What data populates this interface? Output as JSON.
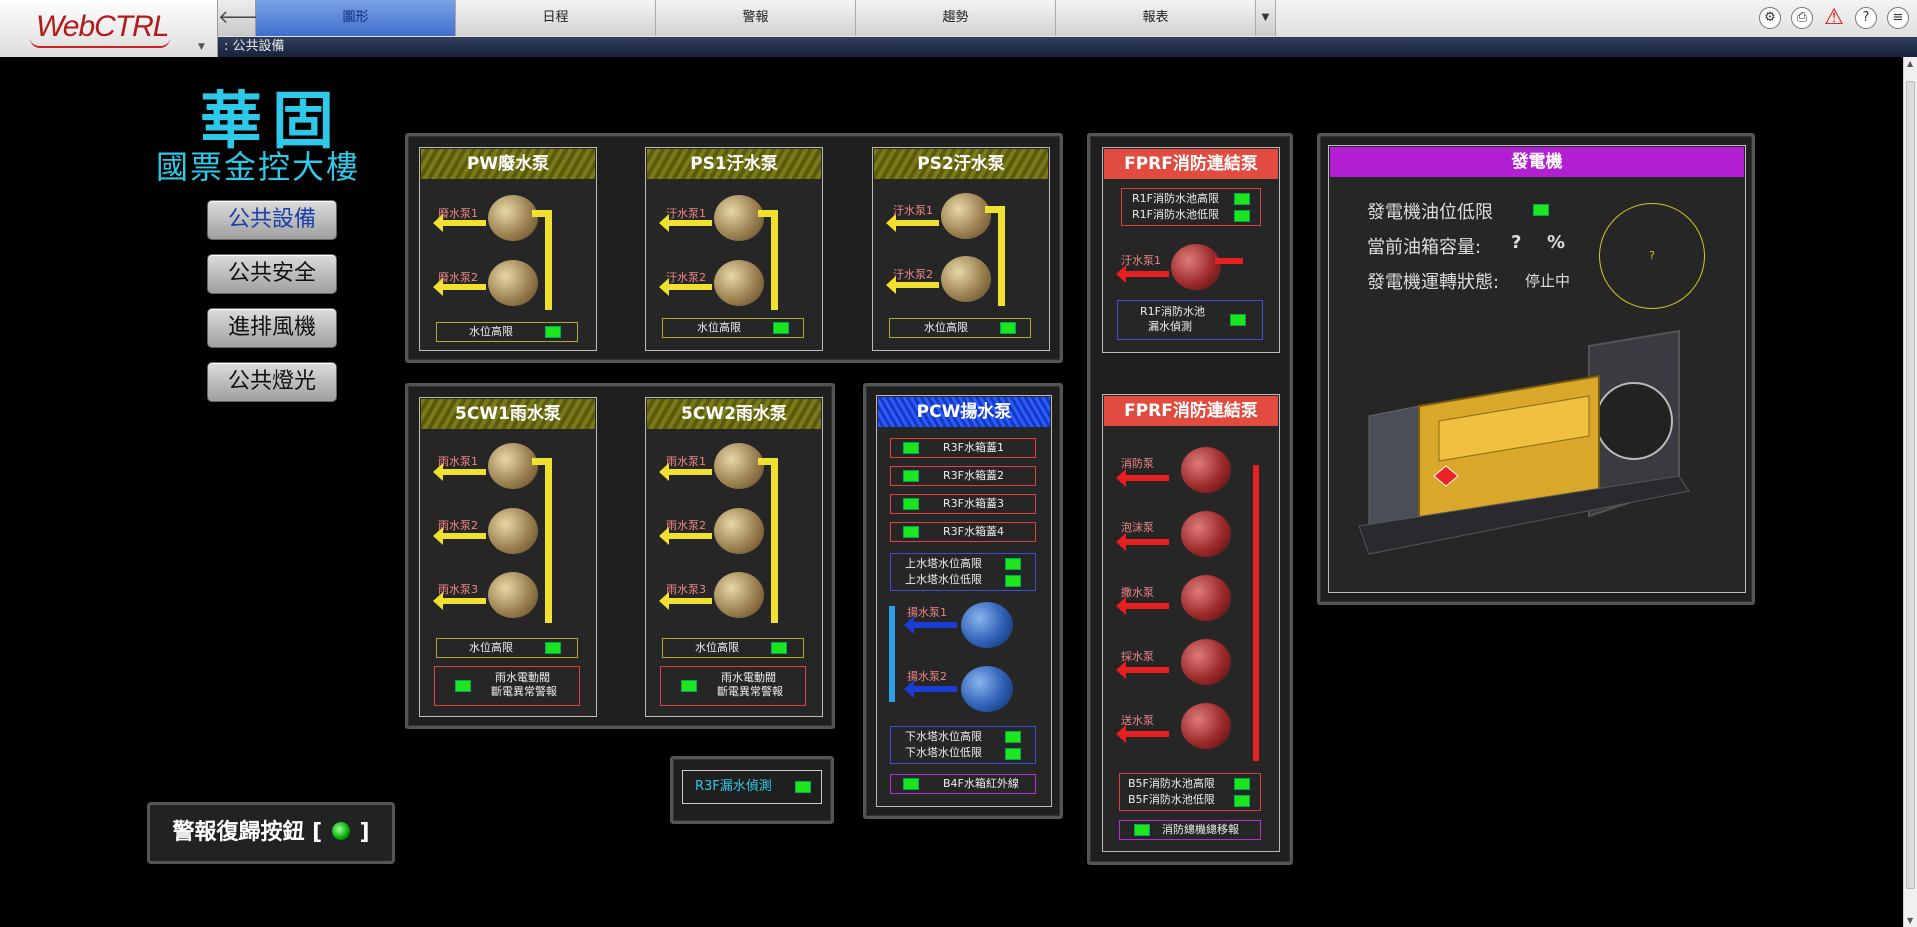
{
  "app": {
    "logo": "WebCTRL"
  },
  "nav": {
    "tabs": [
      "圖形",
      "日程",
      "警報",
      "趨勢",
      "報表"
    ]
  },
  "breadcrumb": ": 公共設備",
  "title": {
    "line1": "華固",
    "line2": "國票金控大樓"
  },
  "side_nav": [
    "公共設備",
    "公共安全",
    "進排風機",
    "公共燈光"
  ],
  "alarm_reset": {
    "label": "警報復歸按鈕 [",
    "suffix": "]"
  },
  "pw": {
    "title": "PW廢水泵",
    "pumps": [
      "廢水泵1",
      "廢水泵2"
    ],
    "level": "水位高限"
  },
  "ps1": {
    "title": "PS1汙水泵",
    "pumps": [
      "汙水泵1",
      "汙水泵2"
    ],
    "level": "水位高限"
  },
  "ps2": {
    "title": "PS2汙水泵",
    "pumps": [
      "汙水泵1",
      "汙水泵2"
    ],
    "level": "水位高限"
  },
  "cw1": {
    "title": "5CW1雨水泵",
    "pumps": [
      "雨水泵1",
      "雨水泵2",
      "雨水泵3"
    ],
    "level": "水位高限",
    "alarm1": "雨水電動閥",
    "alarm2": "斷電異常警報"
  },
  "cw2": {
    "title": "5CW2雨水泵",
    "pumps": [
      "雨水泵1",
      "雨水泵2",
      "雨水泵3"
    ],
    "level": "水位高限",
    "alarm1": "雨水電動閥",
    "alarm2": "斷電異常警報"
  },
  "r3f": {
    "label": "R3F漏水偵測"
  },
  "pcw": {
    "title": "PCW揚水泵",
    "tanks": [
      "R3F水箱蓋1",
      "R3F水箱蓋2",
      "R3F水箱蓋3",
      "R3F水箱蓋4"
    ],
    "upper_high": "上水塔水位高限",
    "upper_low": "上水塔水位低限",
    "pumps": [
      "揚水泵1",
      "揚水泵2"
    ],
    "lower_high": "下水塔水位高限",
    "lower_low": "下水塔水位低限",
    "b4f": "B4F水箱紅外線"
  },
  "fprf1": {
    "title": "FPRF消防連結泵",
    "high": "R1F消防水池高限",
    "low": "R1F消防水池低限",
    "pump": "汙水泵1",
    "leak1": "R1F消防水池",
    "leak2": "漏水偵測"
  },
  "fprf2": {
    "title": "FPRF消防連結泵",
    "pumps": [
      "消防泵",
      "泡沫泵",
      "撒水泵",
      "採水泵",
      "送水泵"
    ],
    "high": "B5F消防水池高限",
    "low": "B5F消防水池低限",
    "relay": "消防總機總移報"
  },
  "gen": {
    "title": "發電機",
    "oil_low": "發電機油位低限",
    "tank_label": "當前油箱容量:",
    "tank_value": "?",
    "tank_unit": "%",
    "run_label": "發電機運轉狀態:",
    "run_value": "停止中",
    "gauge": "?"
  },
  "colors": {
    "led": "#1ee61e",
    "cyan": "#2ec8e8",
    "olive": "#6a6a10",
    "red": "#e24b3f",
    "blue": "#1846e0",
    "purple": "#b21ed2"
  }
}
